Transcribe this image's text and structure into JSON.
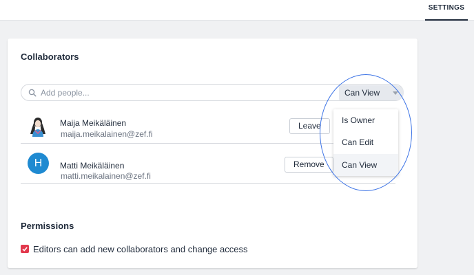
{
  "header": {
    "tab_settings": "SETTINGS"
  },
  "collaborators": {
    "title": "Collaborators",
    "search": {
      "placeholder": "Add people...",
      "value": ""
    },
    "role_select": {
      "selected": "Can View"
    },
    "role_menu": [
      "Is Owner",
      "Can Edit",
      "Can View"
    ],
    "people": [
      {
        "name": "Maija Meikäläinen",
        "email": "maija.meikalainen@zef.fi",
        "action": "Leave",
        "avatar": "photo"
      },
      {
        "name": "Matti Meikäläinen",
        "email": "matti.meikalainen@zef.fi",
        "action": "Remove",
        "avatar": "H"
      }
    ]
  },
  "permissions": {
    "title": "Permissions",
    "checkbox_label": "Editors can add new collaborators and change access",
    "checked": true
  },
  "colors": {
    "accent_blue": "#1f8ad1",
    "highlight_ring": "#3d74e6",
    "checkbox_red": "#e2394d"
  }
}
